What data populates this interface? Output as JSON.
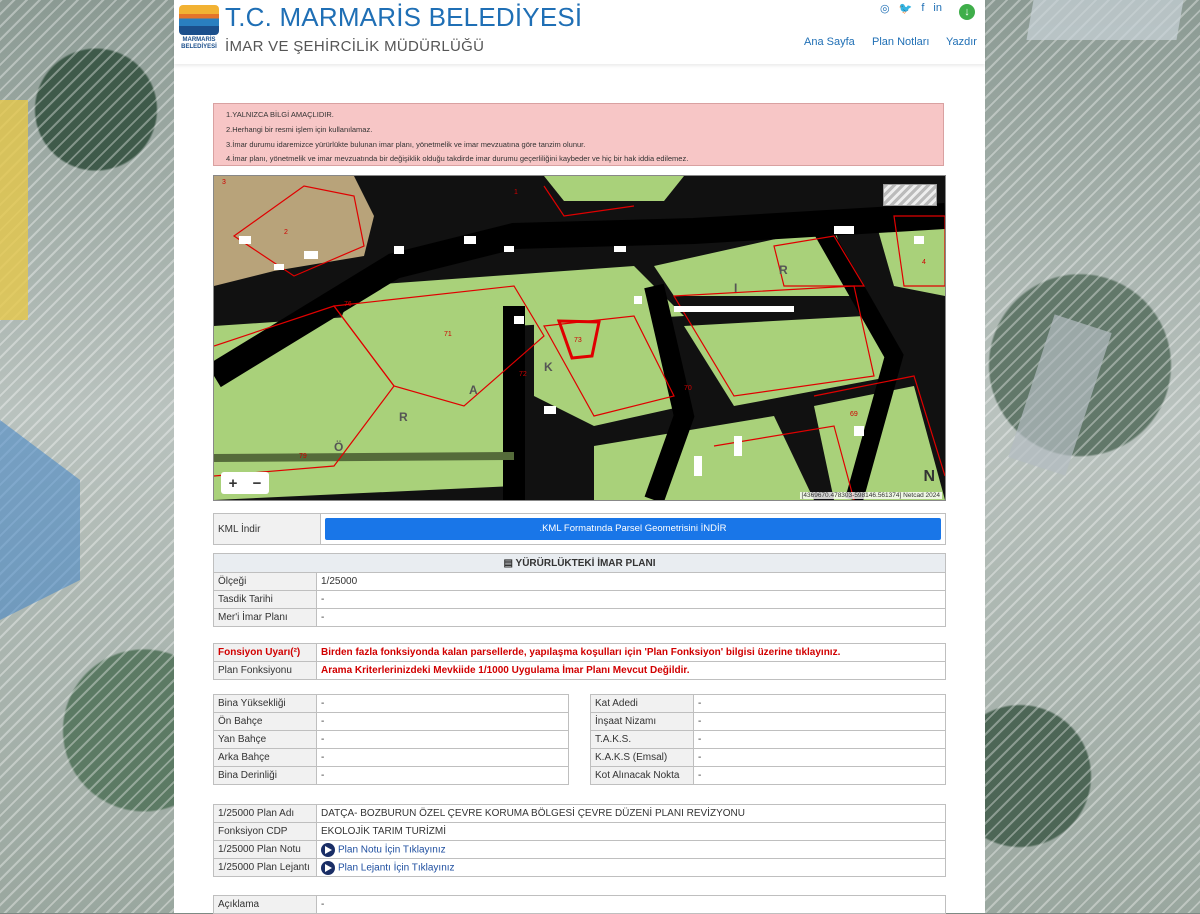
{
  "header": {
    "title": "T.C. MARMARİS BELEDİYESİ",
    "subtitle": "İMAR VE ŞEHİRCİLİK MÜDÜRLÜĞÜ",
    "logo_text": "MARMARİS BELEDİYESİ",
    "social": [
      "◎",
      "🐦",
      "f",
      "in"
    ],
    "download_icon": "↓",
    "nav": [
      "Ana Sayfa",
      "Plan Notları",
      "Yazdır"
    ]
  },
  "warnings": [
    "1.YALNIZCA BİLGİ AMAÇLIDIR.",
    "2.Herhangi bir resmi işlem için kullanılamaz.",
    "3.İmar durumu idaremizce yürürlükte bulunan imar planı, yönetmelik ve imar mevzuatına göre tanzim olunur.",
    "4.İmar planı, yönetmelik ve imar mevzuatında bir değişiklik olduğu takdirde imar durumu geçerliliğini kaybeder ve hiç bir hak iddia edilemez."
  ],
  "map": {
    "zoom_in": "+",
    "zoom_out": "−",
    "coordinates": "[4369670.478303-598146.561374]",
    "credit": "Netcad 2024",
    "north": "N",
    "parcel_labels": [
      "1",
      "2",
      "4",
      "71",
      "72",
      "73",
      "76",
      "69",
      "79",
      "3",
      "70"
    ],
    "place_letters": [
      "Ö",
      "R",
      "A",
      "K",
      "I",
      "R"
    ]
  },
  "kml": {
    "label": "KML İndir",
    "button": ".KML Formatında Parsel Geometrisini İNDİR"
  },
  "plan": {
    "heading": "YÜRÜRLÜKTEKİ İMAR PLANI",
    "rows": [
      {
        "label": "Ölçeği",
        "value": "1/25000"
      },
      {
        "label": "Tasdik Tarihi",
        "value": "-"
      },
      {
        "label": "Mer'i İmar Planı",
        "value": "-"
      }
    ]
  },
  "function": {
    "warning_label": "Fonsiyon Uyarı(²)",
    "warning_text": "Birden fazla fonksiyonda kalan parsellerde, yapılaşma koşulları için 'Plan Fonksiyon' bilgisi üzerine tıklayınız.",
    "plan_label": "Plan Fonksiyonu",
    "plan_text": "Arama Kriterlerinizdeki Mevkiide 1/1000 Uygulama İmar Planı Mevcut Değildir."
  },
  "left_details": [
    {
      "label": "Bina Yüksekliği",
      "value": "-"
    },
    {
      "label": "Ön Bahçe",
      "value": "-"
    },
    {
      "label": "Yan Bahçe",
      "value": "-"
    },
    {
      "label": "Arka Bahçe",
      "value": "-"
    },
    {
      "label": "Bina Derinliği",
      "value": "-"
    }
  ],
  "right_details": [
    {
      "label": "Kat Adedi",
      "value": "-"
    },
    {
      "label": "İnşaat Nizamı",
      "value": "-"
    },
    {
      "label": "T.A.K.S.",
      "value": "-"
    },
    {
      "label": "K.A.K.S (Emsal)",
      "value": "-"
    },
    {
      "label": "Kot Alınacak Nokta",
      "value": "-"
    }
  ],
  "plan25000": {
    "name_label": "1/25000 Plan Adı",
    "name_value": "DATÇA- BOZBURUN ÖZEL ÇEVRE KORUMA BÖLGESİ ÇEVRE DÜZENİ PLANI REVİZYONU",
    "cdp_label": "Fonksiyon CDP",
    "cdp_value": "EKOLOJİK TARIM TURİZMİ",
    "note_label": "1/25000 Plan Notu",
    "note_link": "Plan Notu İçin Tıklayınız",
    "legend_label": "1/25000 Plan Lejantı",
    "legend_link": "Plan Lejantı İçin Tıklayınız"
  },
  "description": {
    "label": "Açıklama",
    "value": "-"
  }
}
